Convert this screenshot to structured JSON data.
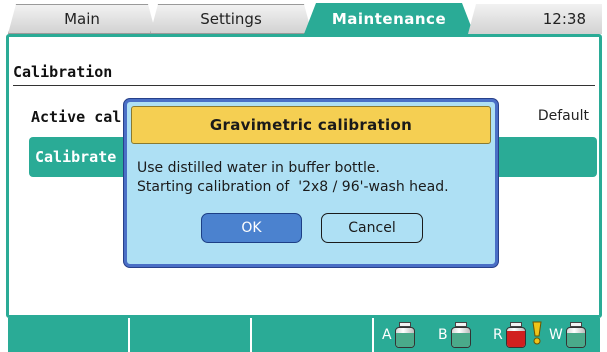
{
  "tabs": [
    {
      "label": "Main",
      "active": false
    },
    {
      "label": "Settings",
      "active": false
    },
    {
      "label": "Maintenance",
      "active": true
    }
  ],
  "clock": "12:38",
  "section": {
    "title": "Calibration",
    "active_label": "Active cal",
    "active_value": "Default",
    "calibrate_label": "Calibrate"
  },
  "dialog": {
    "title": "Gravimetric calibration",
    "message_line1": "Use distilled water in buffer bottle.",
    "message_line2": "Starting calibration of  '2x8 / 96'-wash head.",
    "ok_label": "OK",
    "cancel_label": "Cancel"
  },
  "bottles": [
    {
      "letter": "A",
      "fill_fraction": 0.75,
      "color": "#4aaa8a",
      "warning": false
    },
    {
      "letter": "B",
      "fill_fraction": 0.75,
      "color": "#4aaa8a",
      "warning": false
    },
    {
      "letter": "R",
      "fill_fraction": 0.85,
      "color": "#d1201f",
      "warning": true
    },
    {
      "letter": "W",
      "fill_fraction": 0.75,
      "color": "#4aaa8a",
      "warning": false
    }
  ],
  "colors": {
    "accent": "#2aab96",
    "dialog_bg": "#aee0f4",
    "dialog_title_bg": "#f5cf52",
    "ok_button": "#4b82cf"
  },
  "icons": {
    "warning": "warning-exclamation-icon",
    "bottle": "bottle-icon"
  }
}
